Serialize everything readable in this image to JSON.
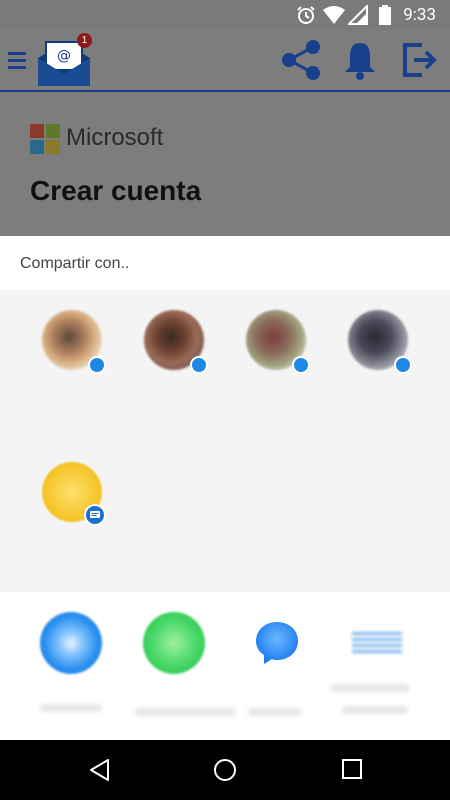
{
  "status_bar": {
    "time": "9:33",
    "icons": [
      "alarm-icon",
      "wifi-icon",
      "signal-icon",
      "battery-icon"
    ]
  },
  "app": {
    "notification_count": "1",
    "brand": "Microsoft",
    "heading": "Crear cuenta",
    "toolbar_icons": [
      "menu-icon",
      "mail-icon",
      "share-icon",
      "bell-icon",
      "logout-icon"
    ]
  },
  "share_sheet": {
    "title": "Compartir con..",
    "direct_targets": [
      {
        "app_badge": "messenger-icon"
      },
      {
        "app_badge": "messenger-icon"
      },
      {
        "app_badge": "messenger-icon"
      },
      {
        "app_badge": "messenger-icon"
      },
      {
        "app_badge": "messages-icon"
      }
    ],
    "app_targets": [
      {
        "icon": "app-icon-blue"
      },
      {
        "icon": "app-icon-green"
      },
      {
        "icon": "messenger-icon"
      },
      {
        "icon": "app-icon-blurred"
      }
    ]
  },
  "nav_bar": {
    "buttons": [
      "back-icon",
      "home-icon",
      "recents-icon"
    ]
  }
}
